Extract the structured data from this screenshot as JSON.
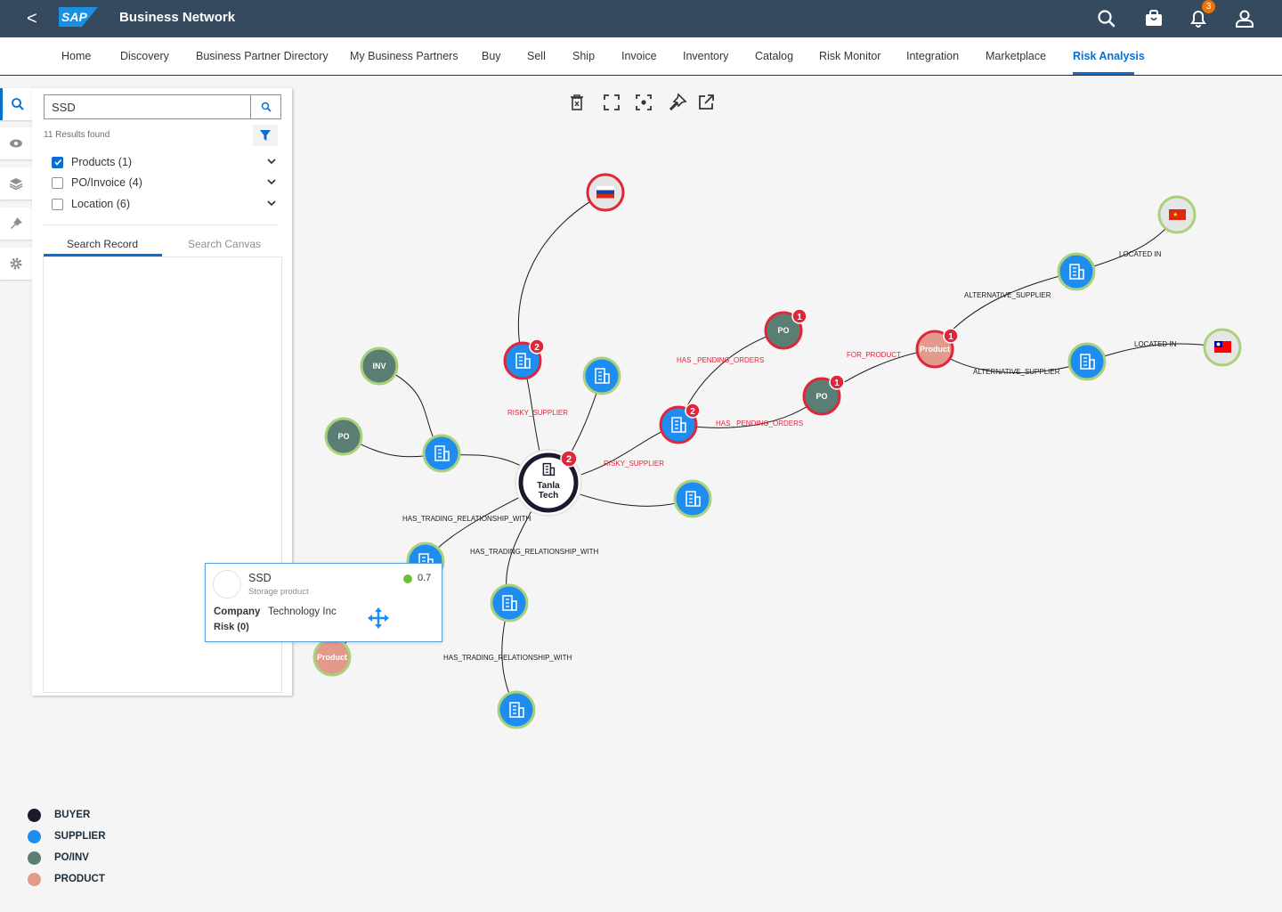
{
  "shell": {
    "back_label": "<",
    "logo_text": "SAP",
    "title": "Business Network",
    "notifications_count": "3"
  },
  "nav": {
    "items": [
      "Home",
      "Discovery",
      "Business Partner Directory",
      "My Business Partners",
      "Buy",
      "Sell",
      "Ship",
      "Invoice",
      "Inventory",
      "Catalog",
      "Risk Monitor",
      "Integration",
      "Marketplace",
      "Risk Analysis"
    ],
    "active": "Risk Analysis"
  },
  "search": {
    "value": "SSD",
    "results_text": "11 Results found",
    "categories": [
      {
        "label": "Products (1)",
        "checked": true
      },
      {
        "label": "PO/Invoice (4)",
        "checked": false
      },
      {
        "label": "Location (6)",
        "checked": false
      }
    ],
    "tabs": [
      "Search Record",
      "Search Canvas"
    ],
    "active_tab": "Search Record"
  },
  "graph": {
    "center": {
      "line1": "Tanla",
      "line2": "Tech",
      "badge": "2"
    },
    "node_labels": {
      "po": "PO",
      "inv": "INV",
      "product": "Product"
    },
    "badges": {
      "risky_supplier_top": "2",
      "risky_supplier_right": "2",
      "po_top": "1",
      "po_mid": "1",
      "product_right": "1"
    },
    "edge_labels": {
      "risky_supplier_1": "RISKY_SUPPLIER",
      "risky_supplier_2": "RISKY_SUPPLIER",
      "has_pending_orders_1": "HAS _PENDING_ORDERS",
      "has_pending_orders_2": "HAS _PENDING_ORDERS",
      "for_product": "FOR_PRODUCT",
      "alternative_supplier_1": "ALTERNATIVE_SUPPLIER",
      "alternative_supplier_2": "ALTERNATIVE_SUPPLIER",
      "located_in_1": "LOCATED IN",
      "located_in_2": "LOCATED IN",
      "has_trading_1": "HAS_TRADING_RELATIONSHIP_WITH",
      "has_trading_2": "HAS_TRADING_RELATIONSHIP_WITH",
      "has_trading_3": "HAS_TRADING_RELATIONSHIP_WITH"
    }
  },
  "popover": {
    "title": "SSD",
    "subtitle": "Storage product",
    "score": "0.7",
    "company_label": "Company",
    "company_value": "Technology Inc",
    "risk": "Risk (0)"
  },
  "legend": [
    {
      "label": "BUYER",
      "color": "#1a1a2e"
    },
    {
      "label": "SUPPLIER",
      "color": "#1f8cf0"
    },
    {
      "label": "PO/INV",
      "color": "#5a7d74"
    },
    {
      "label": "PRODUCT",
      "color": "#e39a8a"
    }
  ],
  "colors": {
    "shell": "#354a5f",
    "accent": "#0a6ed1",
    "supplier": "#1f8cf0",
    "po": "#5a7d74",
    "product": "#e39a8a",
    "risk_ring": "#e0263a",
    "ok_ring": "#a9d17c",
    "badge": "#e0263a"
  },
  "icons": [
    "back-icon",
    "search-icon",
    "briefcase-icon",
    "bell-icon",
    "user-icon",
    "filter-icon",
    "chevron-down-icon",
    "eye-icon",
    "layers-icon",
    "pin-icon",
    "settings-icon",
    "delete-icon",
    "fullscreen-icon",
    "focus-icon",
    "pin-icon",
    "open-external-icon",
    "building-icon",
    "flag-icon",
    "move-icon"
  ]
}
